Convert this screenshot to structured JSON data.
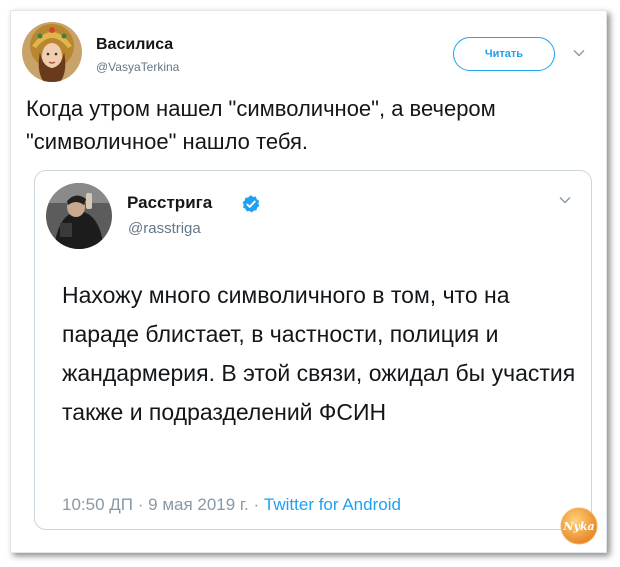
{
  "tweet": {
    "author_name": "Василиса",
    "author_handle": "@VasyaTerkina",
    "follow_label": "Читать",
    "text": "Когда утром нашел \"символичное\", а вечером \"символичное\" нашло тебя."
  },
  "quoted_tweet": {
    "author_name": "Расстрига",
    "author_handle": "@rasstriga",
    "verified": true,
    "text": "Нахожу много символичного в том, что на параде блистает, в частности, полиция и жандармерия. В этой связи, ожидал бы участия также и подразделений ФСИН",
    "time": "10:50 ДП",
    "separator": "·",
    "date": "9 мая 2019 г.",
    "source": "Twitter for Android"
  },
  "watermark": {
    "text": "Nyka"
  },
  "icons": {
    "caret": "chevron-down-icon",
    "verified": "verified-badge-icon"
  },
  "colors": {
    "accent": "#1da1f2",
    "text": "#14171a",
    "secondary": "#657786",
    "meta": "#8899a6",
    "border": "#ccd6dd"
  }
}
